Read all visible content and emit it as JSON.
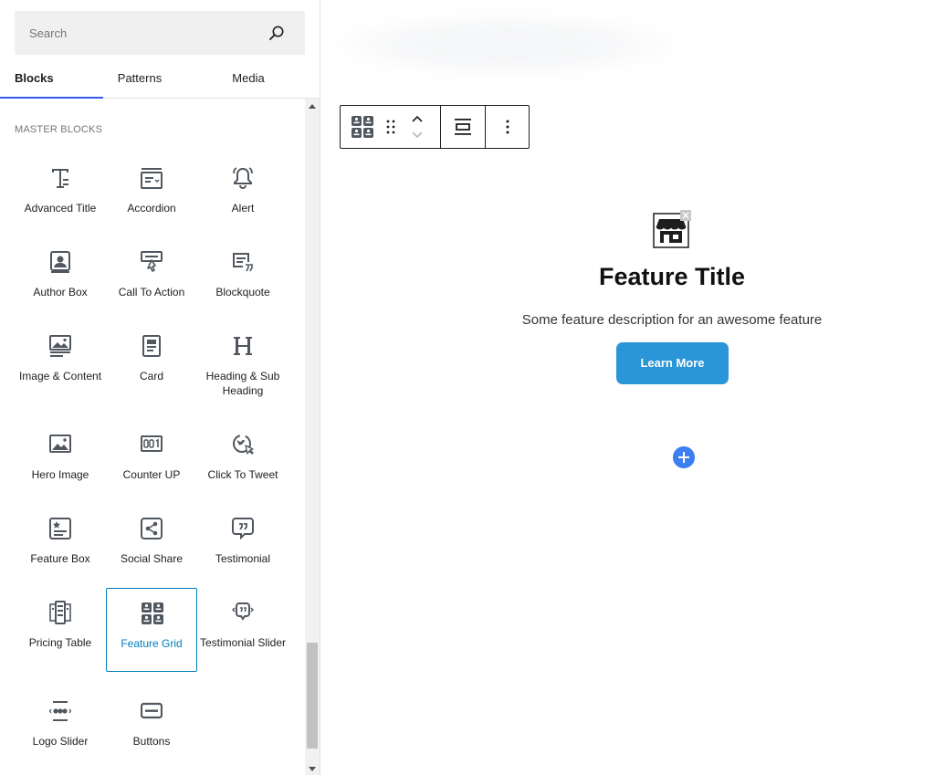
{
  "search": {
    "placeholder": "Search",
    "icon": "search-icon"
  },
  "tabs": [
    {
      "label": "Blocks",
      "active": true
    },
    {
      "label": "Patterns",
      "active": false
    },
    {
      "label": "Media",
      "active": false
    }
  ],
  "category": "MASTER BLOCKS",
  "blocks": [
    {
      "label": "Advanced Title",
      "icon": "advanced-title-icon"
    },
    {
      "label": "Accordion",
      "icon": "accordion-icon"
    },
    {
      "label": "Alert",
      "icon": "bell-icon"
    },
    {
      "label": "Author Box",
      "icon": "author-box-icon"
    },
    {
      "label": "Call To Action",
      "icon": "call-to-action-icon"
    },
    {
      "label": "Blockquote",
      "icon": "blockquote-icon"
    },
    {
      "label": "Image & Content",
      "icon": "image-content-icon"
    },
    {
      "label": "Card",
      "icon": "card-icon"
    },
    {
      "label": "Heading & Sub Heading",
      "icon": "heading-icon"
    },
    {
      "label": "Hero Image",
      "icon": "hero-image-icon"
    },
    {
      "label": "Counter UP",
      "icon": "counter-icon"
    },
    {
      "label": "Click To Tweet",
      "icon": "tweet-icon"
    },
    {
      "label": "Feature Box",
      "icon": "feature-box-icon"
    },
    {
      "label": "Social Share",
      "icon": "share-icon"
    },
    {
      "label": "Testimonial",
      "icon": "testimonial-icon"
    },
    {
      "label": "Pricing Table",
      "icon": "pricing-table-icon"
    },
    {
      "label": "Feature Grid",
      "icon": "feature-grid-icon",
      "selected": true
    },
    {
      "label": "Testimonial Slider",
      "icon": "testimonial-slider-icon"
    },
    {
      "label": "Logo Slider",
      "icon": "logo-slider-icon"
    },
    {
      "label": "Buttons",
      "icon": "buttons-icon"
    }
  ],
  "toolbar": {
    "block_icon": "feature-grid-icon",
    "drag": "drag-handle-icon",
    "move": "move-up-down-icon",
    "align": "align-icon",
    "more": "more-options-icon"
  },
  "feature": {
    "icon": "store-icon",
    "title": "Feature Title",
    "description": "Some feature description for an awesome feature",
    "button": "Learn More"
  },
  "add_block": {
    "icon": "plus-icon"
  },
  "colors": {
    "accent": "#007cba",
    "tab_indicator": "#3858e9",
    "button": "#2b96d7",
    "add_button": "#3c7ff0"
  }
}
